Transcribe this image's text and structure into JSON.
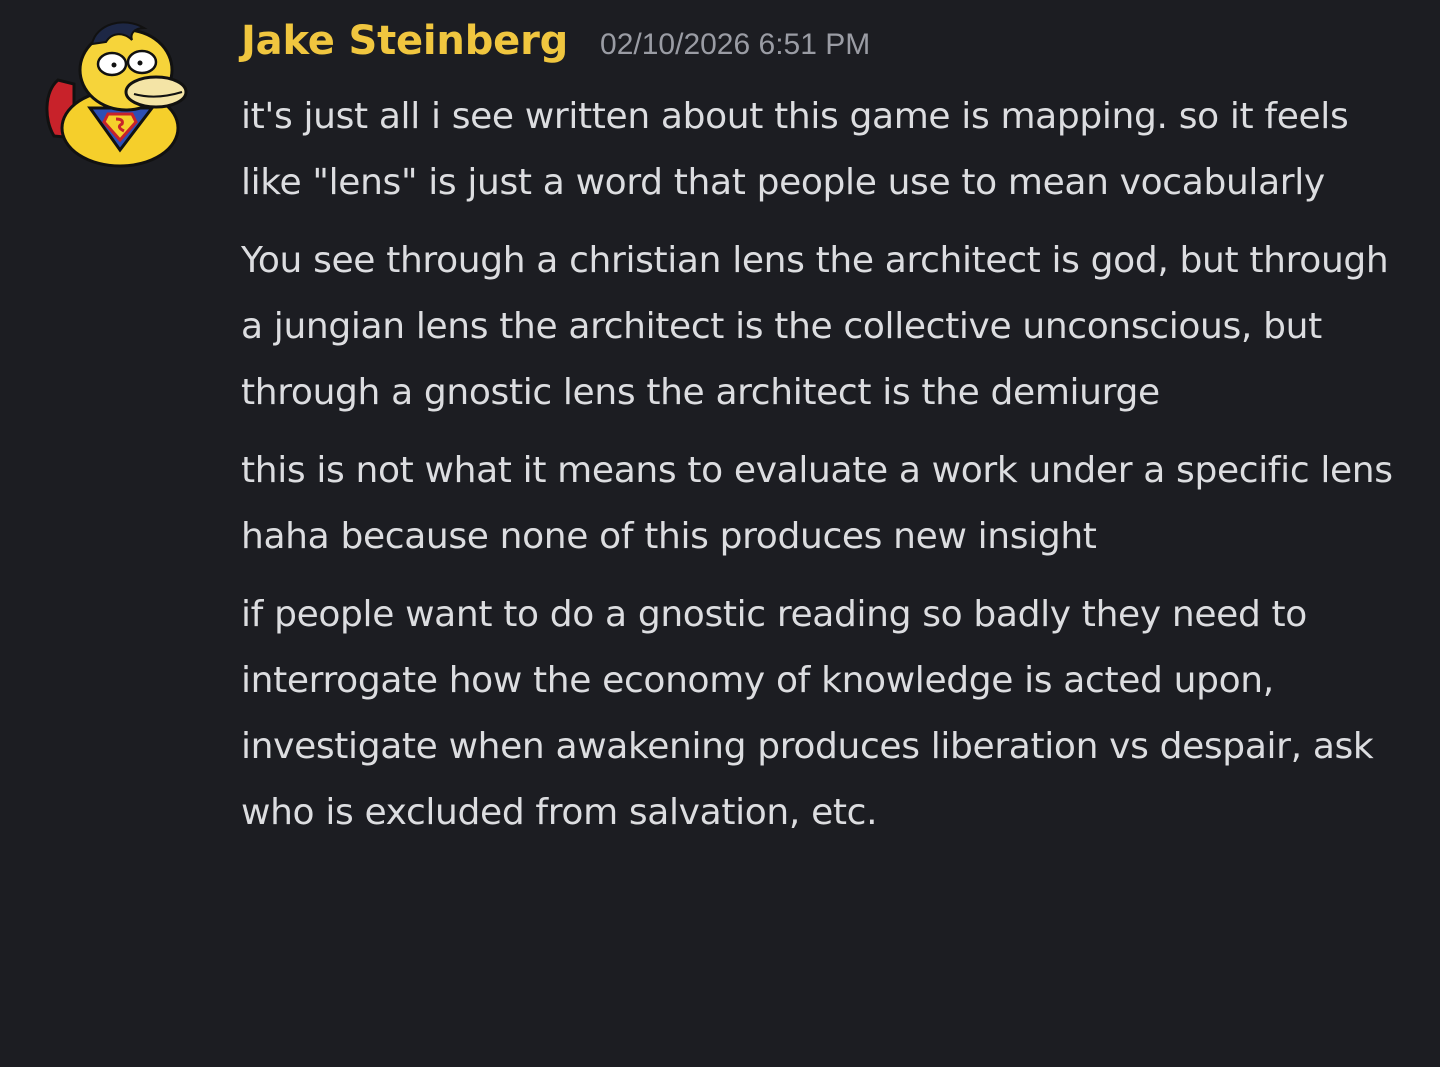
{
  "author": {
    "name": "Jake Steinberg",
    "name_color": "#f0c63f",
    "avatar_icon": "psyduck-superman-avatar"
  },
  "timestamp": "02/10/2026 6:51 PM",
  "messages": [
    "it's just all i see written about this game is mapping. so it feels like \"lens\" is just a word that people use to mean vocabularly",
    "You see through a christian lens the architect is god, but through a jungian lens the architect is the collective unconscious, but through a gnostic lens the architect is the demiurge",
    "this is not what it means to evaluate a work under a specific lens haha because none of this produces new insight",
    "if people want to do a gnostic reading so badly they need to interrogate how the economy of knowledge is acted upon, investigate when awakening produces liberation vs despair, ask who is excluded from salvation, etc."
  ]
}
